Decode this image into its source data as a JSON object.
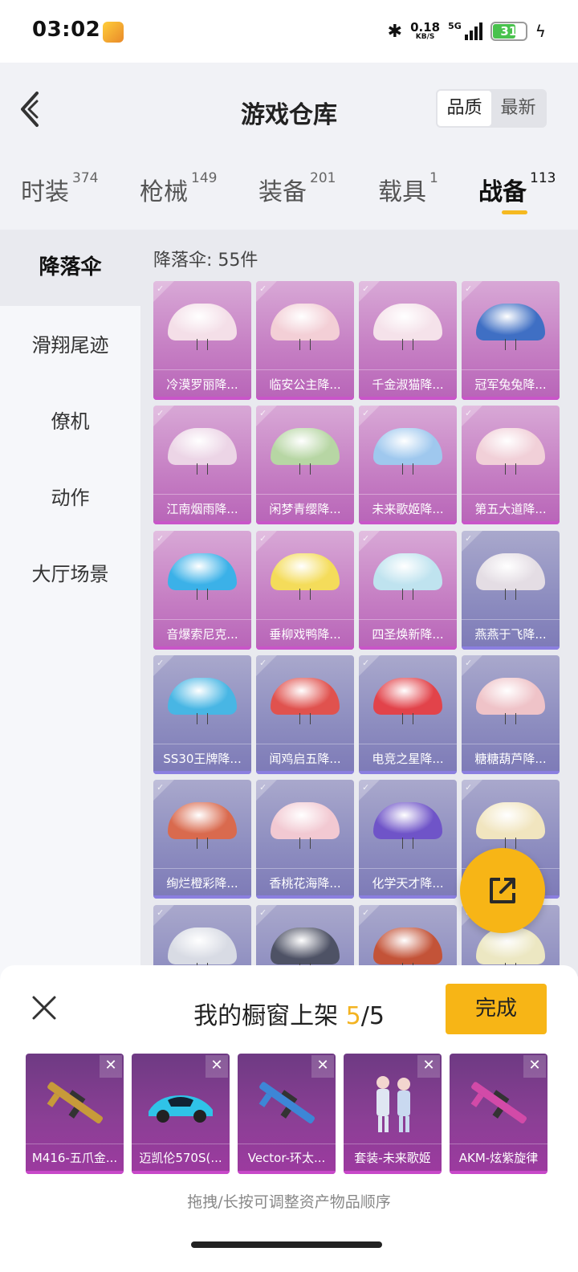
{
  "status_bar": {
    "time": "03:02",
    "network_speed_value": "0.18",
    "network_speed_unit": "KB/S",
    "network_type": "5G",
    "battery": "31"
  },
  "header": {
    "title": "游戏仓库",
    "sort_options": [
      "品质",
      "最新"
    ],
    "sort_selected": "品质"
  },
  "tabs": [
    {
      "label": "时装",
      "count": "374"
    },
    {
      "label": "枪械",
      "count": "149"
    },
    {
      "label": "装备",
      "count": "201"
    },
    {
      "label": "载具",
      "count": "1"
    },
    {
      "label": "战备",
      "count": "113"
    }
  ],
  "active_tab": "战备",
  "sidebar": {
    "items": [
      {
        "label": "降落伞"
      },
      {
        "label": "滑翔尾迹"
      },
      {
        "label": "僚机"
      },
      {
        "label": "动作"
      },
      {
        "label": "大厅场景"
      }
    ],
    "active": "降落伞"
  },
  "grid": {
    "count_label": "降落伞: 55件",
    "items": [
      {
        "name": "冷漠罗丽降...",
        "rarity": "pink",
        "color": "#f4dfe8"
      },
      {
        "name": "临安公主降...",
        "rarity": "pink",
        "color": "#f3cfd6"
      },
      {
        "name": "千金淑猫降...",
        "rarity": "pink",
        "color": "#f5e2ea"
      },
      {
        "name": "冠军兔兔降...",
        "rarity": "pink",
        "color": "#3f6fc4"
      },
      {
        "name": "江南烟雨降...",
        "rarity": "pink",
        "color": "#ecd5e6"
      },
      {
        "name": "闲梦青缨降...",
        "rarity": "pink",
        "color": "#b7d6a4"
      },
      {
        "name": "未来歌姬降...",
        "rarity": "pink",
        "color": "#9fc8ee"
      },
      {
        "name": "第五大道降...",
        "rarity": "pink",
        "color": "#f1d0d8"
      },
      {
        "name": "音爆索尼克...",
        "rarity": "pink",
        "color": "#3bb1e8"
      },
      {
        "name": "垂柳戏鸭降...",
        "rarity": "pink",
        "color": "#f4dc5a"
      },
      {
        "name": "四圣焕新降...",
        "rarity": "pink",
        "color": "#bfe3ef"
      },
      {
        "name": "燕燕于飞降...",
        "rarity": "blue",
        "color": "#e4dde4"
      },
      {
        "name": "SS30王牌降...",
        "rarity": "blue",
        "color": "#48b6e4"
      },
      {
        "name": "闻鸡启五降...",
        "rarity": "blue",
        "color": "#e0524e"
      },
      {
        "name": "电竞之星降...",
        "rarity": "blue",
        "color": "#e2434a"
      },
      {
        "name": "糖糖葫芦降...",
        "rarity": "blue",
        "color": "#efc3c8"
      },
      {
        "name": "绚烂橙彩降...",
        "rarity": "blue",
        "color": "#d96a4e"
      },
      {
        "name": "香桃花海降...",
        "rarity": "blue",
        "color": "#f2c9d2"
      },
      {
        "name": "化学天才降...",
        "rarity": "blue",
        "color": "#6f54c8"
      },
      {
        "name": "",
        "rarity": "blue",
        "color": "#f1e5bf"
      },
      {
        "name": "",
        "rarity": "blue",
        "color": "#d8dbe4"
      },
      {
        "name": "",
        "rarity": "blue",
        "color": "#4e5265"
      },
      {
        "name": "",
        "rarity": "blue",
        "color": "#c35338"
      },
      {
        "name": "",
        "rarity": "blue",
        "color": "#ece7c2"
      }
    ]
  },
  "showcase": {
    "title_prefix": "我的橱窗上架",
    "current": "5",
    "total": "/5",
    "done_label": "完成",
    "items": [
      {
        "name": "M416-五爪金...",
        "icon": "rifle-icon",
        "color": "#c79a3a"
      },
      {
        "name": "迈凯伦570S(...",
        "icon": "car-icon",
        "color": "#2fc3e8"
      },
      {
        "name": "Vector-环太...",
        "icon": "smg-icon",
        "color": "#3d86d6"
      },
      {
        "name": "套装-未来歌姬",
        "icon": "outfit-icon",
        "color": "#dfe6f2"
      },
      {
        "name": "AKM-炫紫旋律",
        "icon": "rifle-icon",
        "color": "#d24aa8"
      }
    ],
    "hint": "拖拽/长按可调整资产物品顺序"
  },
  "colors": {
    "accent": "#f7b516",
    "legendary_card": "#c680c4",
    "epic_card": "#8e8ec0"
  }
}
